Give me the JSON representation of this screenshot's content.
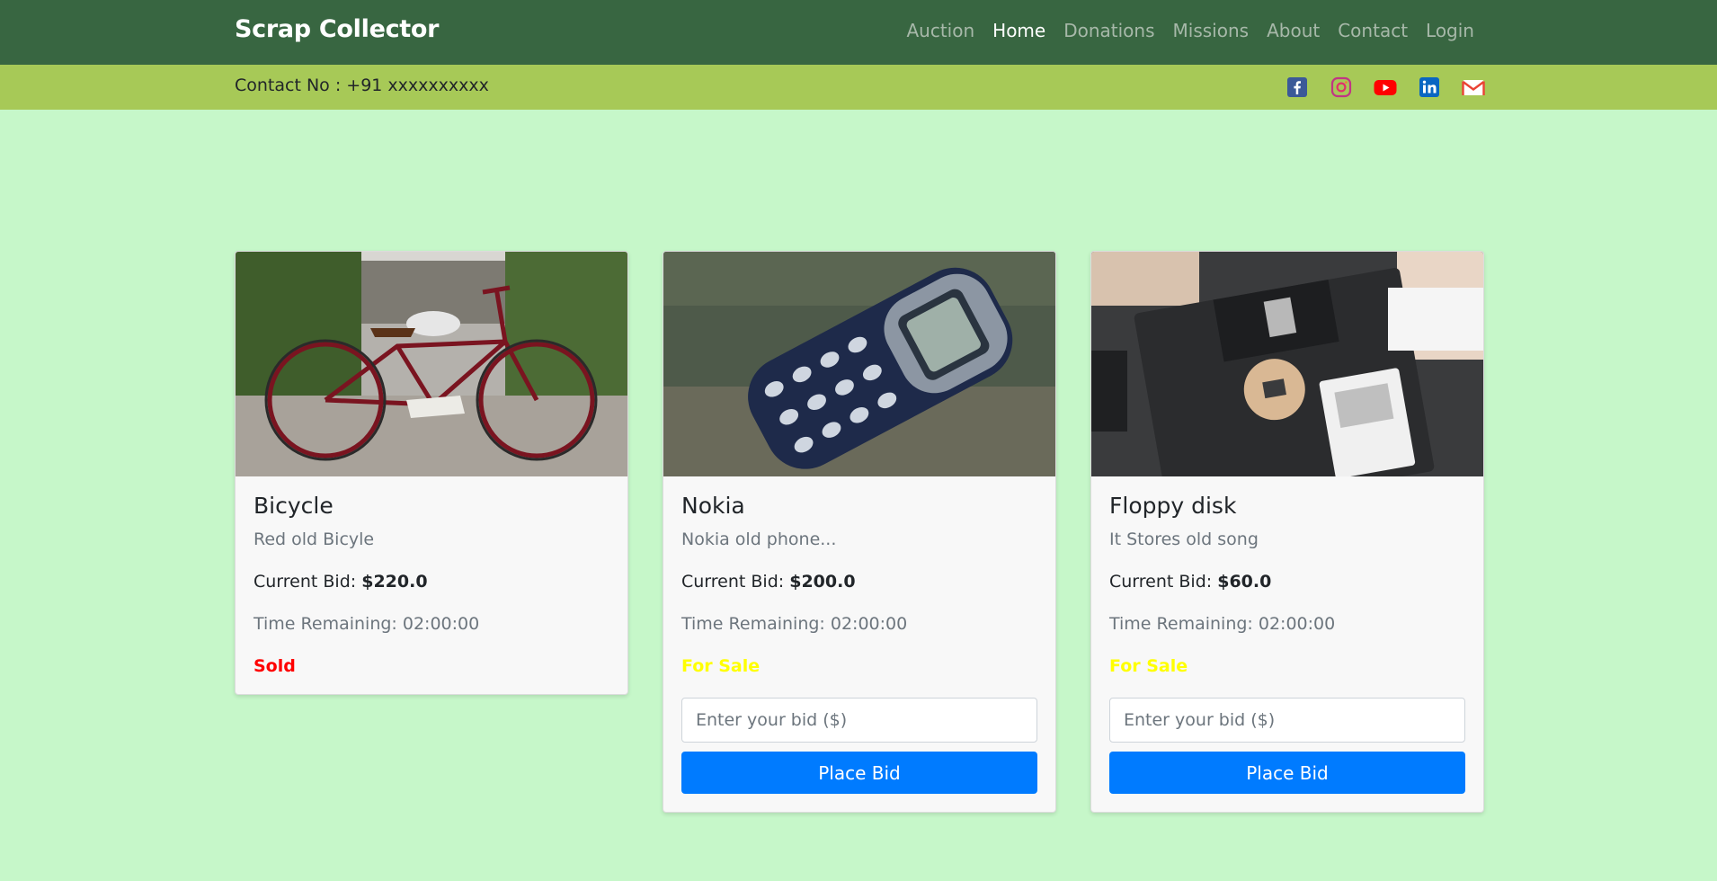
{
  "brand": "Scrap Collector",
  "nav": [
    {
      "label": "Auction",
      "active": false
    },
    {
      "label": "Home",
      "active": true
    },
    {
      "label": "Donations",
      "active": false
    },
    {
      "label": "Missions",
      "active": false
    },
    {
      "label": "About",
      "active": false
    },
    {
      "label": "Contact",
      "active": false
    },
    {
      "label": "Login",
      "active": false
    }
  ],
  "contact": {
    "text": "Contact No : +91 xxxxxxxxxx"
  },
  "socials": [
    "facebook-icon",
    "instagram-icon",
    "youtube-icon",
    "linkedin-icon",
    "gmail-icon"
  ],
  "colors": {
    "nav_bg": "#386641",
    "contact_bg": "#a7c957",
    "page_bg": "#c6f7c9",
    "sold": "#ff0000",
    "for_sale": "#ffff00",
    "button": "#007bff"
  },
  "cards": [
    {
      "title": "Bicycle",
      "description": "Red old Bicyle",
      "bid_label": "Current Bid: ",
      "bid_value": "$220.0",
      "time": "Time Remaining: 02:00:00",
      "status": "Sold",
      "image": "bicycle-photo"
    },
    {
      "title": "Nokia",
      "description": "Nokia old phone...",
      "bid_label": "Current Bid: ",
      "bid_value": "$200.0",
      "time": "Time Remaining: 02:00:00",
      "status": "For Sale",
      "image": "nokia-phone-photo",
      "input_placeholder": "Enter your bid ($)",
      "button_label": "Place Bid"
    },
    {
      "title": "Floppy disk",
      "description": "It Stores old song",
      "bid_label": "Current Bid: ",
      "bid_value": "$60.0",
      "time": "Time Remaining: 02:00:00",
      "status": "For Sale",
      "image": "floppy-disks-photo",
      "input_placeholder": "Enter your bid ($)",
      "button_label": "Place Bid"
    }
  ]
}
